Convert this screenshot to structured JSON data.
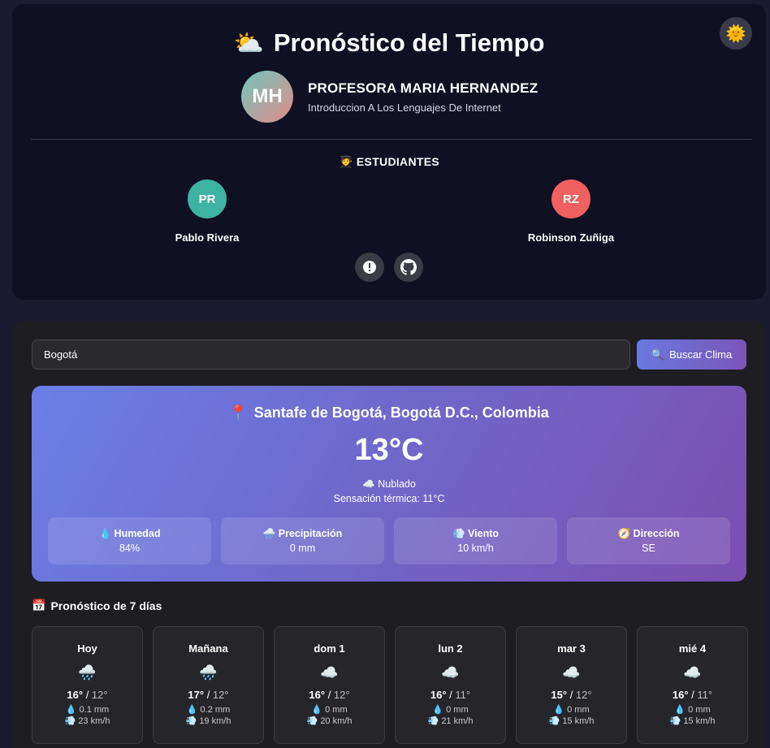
{
  "header": {
    "title": "Pronóstico del Tiempo",
    "title_icon": "sun-behind-cloud-icon",
    "theme_icon": "sun-icon",
    "professor": {
      "initials": "MH",
      "name": "PROFESORA MARIA HERNANDEZ",
      "course": "Introduccion A Los Lenguajes De Internet"
    },
    "students_title": "ESTUDIANTES",
    "students": [
      {
        "initials": "PR",
        "name": "Pablo Rivera",
        "color": "#3fb3a3"
      },
      {
        "initials": "RZ",
        "name": "Robinson Zuñiga",
        "color": "#f06060"
      }
    ],
    "social_icons": [
      "info-icon",
      "github-icon"
    ]
  },
  "search": {
    "value": "Bogotá",
    "button_label": "Buscar Clima"
  },
  "current": {
    "location": "Santafe de Bogotá, Bogotá D.C., Colombia",
    "temperature": "13°C",
    "condition": "Nublado",
    "feels_like": "Sensación térmica: 11°C",
    "stats": [
      {
        "icon": "droplet-icon",
        "label": "Humedad",
        "value": "84%"
      },
      {
        "icon": "rain-cloud-icon",
        "label": "Precipitación",
        "value": "0 mm"
      },
      {
        "icon": "wind-icon",
        "label": "Viento",
        "value": "10 km/h"
      },
      {
        "icon": "compass-icon",
        "label": "Dirección",
        "value": "SE"
      }
    ]
  },
  "forecast": {
    "title": "Pronóstico de 7 días",
    "days": [
      {
        "name": "Hoy",
        "icon": "rain-cloud-icon",
        "high": "16°",
        "low": "12°",
        "precip": "0.1 mm",
        "wind": "23 km/h"
      },
      {
        "name": "Mañana",
        "icon": "rain-cloud-icon",
        "high": "17°",
        "low": "12°",
        "precip": "0.2 mm",
        "wind": "19 km/h"
      },
      {
        "name": "dom 1",
        "icon": "cloud-icon",
        "high": "16°",
        "low": "12°",
        "precip": "0 mm",
        "wind": "20 km/h"
      },
      {
        "name": "lun 2",
        "icon": "cloud-icon",
        "high": "16°",
        "low": "11°",
        "precip": "0 mm",
        "wind": "21 km/h"
      },
      {
        "name": "mar 3",
        "icon": "cloud-icon",
        "high": "15°",
        "low": "12°",
        "precip": "0 mm",
        "wind": "15 km/h"
      },
      {
        "name": "mié 4",
        "icon": "cloud-icon",
        "high": "16°",
        "low": "11°",
        "precip": "0 mm",
        "wind": "15 km/h"
      }
    ]
  }
}
